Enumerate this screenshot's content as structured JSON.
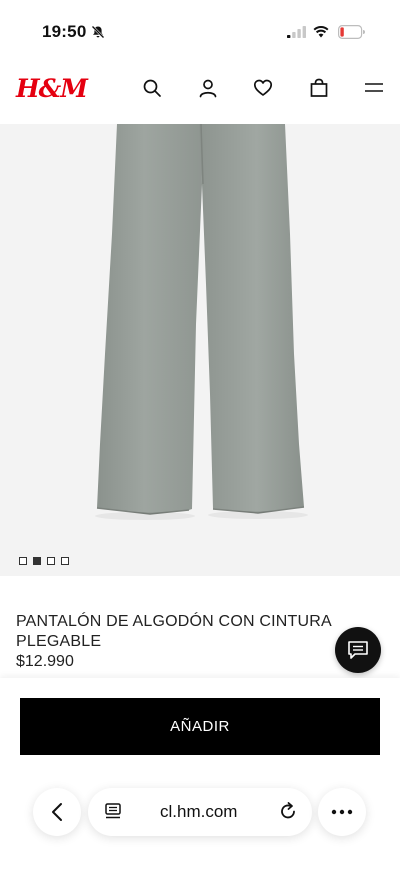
{
  "status_bar": {
    "time": "19:50",
    "icons": [
      "bell-slash-icon",
      "signal-icon",
      "wifi-icon",
      "battery-low-icon"
    ],
    "battery_color": "#e53935"
  },
  "header": {
    "logo": "H&M",
    "logo_color": "#e50010",
    "icons": [
      "search-icon",
      "account-icon",
      "heart-icon",
      "bag-icon",
      "menu-icon"
    ]
  },
  "product": {
    "image_icon": "gray-flared-pants-image",
    "gallery": {
      "count": 4,
      "active_index": 1
    },
    "name": "PANTALÓN DE ALGODÓN CON CINTURA PLEGABLE",
    "price": "$12.990"
  },
  "actions": {
    "add_label": "AÑADIR",
    "chat_icon": "chat-icon"
  },
  "browser": {
    "url": "cl.hm.com",
    "icons": [
      "back-icon",
      "reader-icon",
      "reload-icon",
      "more-icon"
    ]
  }
}
